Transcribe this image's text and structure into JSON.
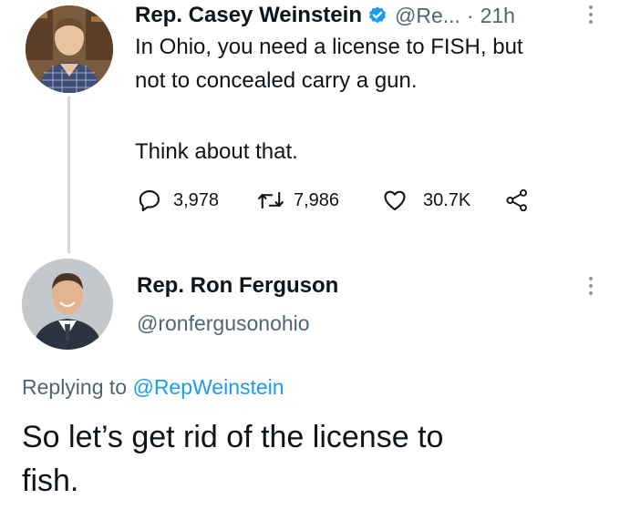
{
  "tweet": {
    "author_name": "Rep. Casey Weinstein",
    "handle_truncated": "@Re...",
    "separator": "·",
    "time": "21h",
    "verified_badge_icon": "verified-badge-icon",
    "text_lines": [
      "In Ohio, you need a license to FISH, but",
      "not to concealed carry a gun."
    ],
    "text_line3": "Think about that.",
    "actions": {
      "reply_count": "3,978",
      "retweet_count": "7,986",
      "like_count": "30.7K"
    },
    "icons": [
      "reply-icon",
      "retweet-icon",
      "like-icon",
      "share-icon",
      "more-options-icon"
    ]
  },
  "reply": {
    "author_name": "Rep. Ron Ferguson",
    "handle": "@ronfergusonohio",
    "replying_prefix": "Replying to",
    "replying_handle": "@RepWeinstein",
    "text_lines": [
      "So let’s get rid of the license to",
      "fish."
    ],
    "icons": [
      "more-options-icon"
    ]
  },
  "colors": {
    "text": "#0f1419",
    "muted": "#536471",
    "link": "#1d9bf0",
    "verified": "#1d9bf0",
    "thread_line": "#cfd9de"
  }
}
